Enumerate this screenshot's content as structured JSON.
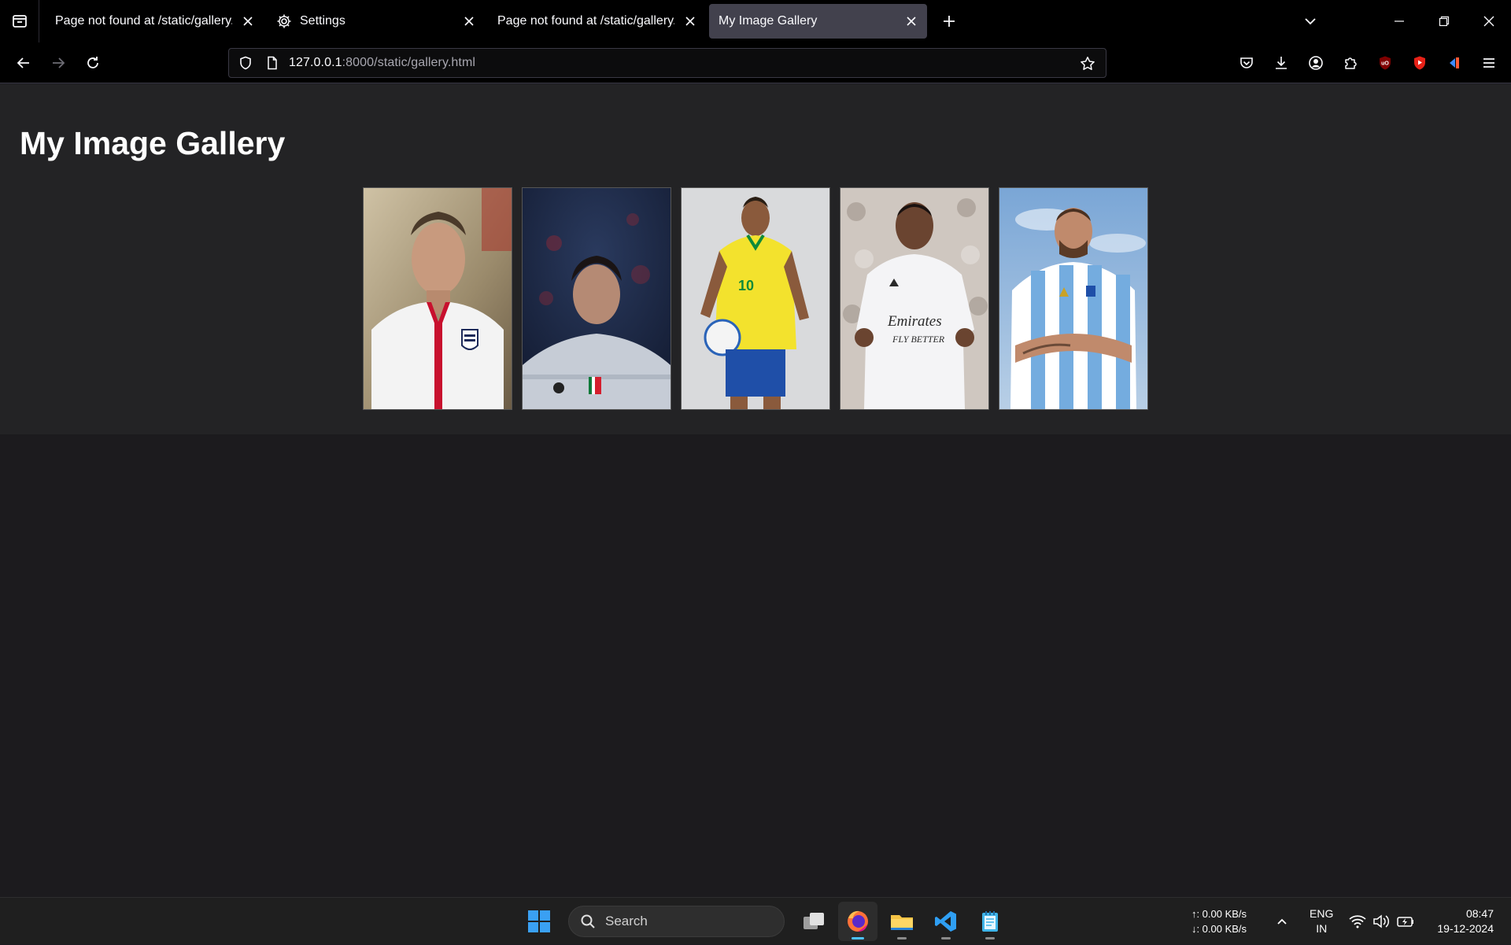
{
  "browser": {
    "tabs": [
      {
        "label": "Page not found at /static/gallery.html",
        "active": false,
        "icon": "none"
      },
      {
        "label": "Settings",
        "active": false,
        "icon": "gear-icon"
      },
      {
        "label": "Page not found at /static/gallery.html",
        "active": false,
        "icon": "none"
      },
      {
        "label": "My Image Gallery",
        "active": true,
        "icon": "none"
      }
    ],
    "url": {
      "host": "127.0.0.1",
      "rest": ":8000/static/gallery.html"
    }
  },
  "page": {
    "title": "My Image Gallery",
    "images": [
      {
        "subject": "footballer-england-kit",
        "palette": [
          "#b8a98a",
          "#f2f2f2",
          "#c0162b"
        ]
      },
      {
        "subject": "footballer-juventus-kit",
        "palette": [
          "#1b2744",
          "#c7cdd6",
          "#8a2436"
        ]
      },
      {
        "subject": "footballer-brazil-kit",
        "palette": [
          "#d9dadc",
          "#f3e22d",
          "#1f4fa8"
        ]
      },
      {
        "subject": "footballer-real-madrid-kit",
        "palette": [
          "#d6d1cc",
          "#f4f4f6",
          "#3a3a3a"
        ]
      },
      {
        "subject": "footballer-argentina-kit",
        "palette": [
          "#8fb3d9",
          "#74acdf",
          "#ffffff"
        ]
      }
    ]
  },
  "taskbar": {
    "search_label": "Search",
    "net_up": "↑: 0.00 KB/s",
    "net_down": "↓: 0.00 KB/s",
    "lang_top": "ENG",
    "lang_bottom": "IN",
    "time": "08:47",
    "date": "19-12-2024"
  }
}
